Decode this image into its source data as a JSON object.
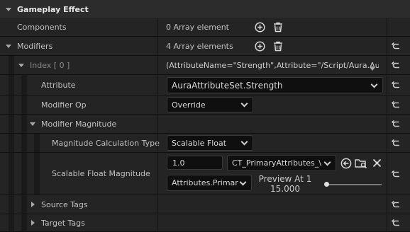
{
  "header": {
    "title": "Gameplay Effect"
  },
  "components": {
    "label": "Components",
    "value": "0 Array element"
  },
  "modifiers": {
    "label": "Modifiers",
    "value": "4 Array elements",
    "index": {
      "label": "Index [ 0 ]",
      "value": "(AttributeName=\"Strength\",Attribute=\"/Script/Aura.Au"
    },
    "attribute": {
      "label": "Attribute",
      "value": "AuraAttributeSet.Strength"
    },
    "modifier_op": {
      "label": "Modifier Op",
      "value": "Override"
    },
    "modifier_magnitude": {
      "label": "Modifier Magnitude"
    },
    "calc_type": {
      "label": "Magnitude Calculation Type",
      "value": "Scalable Float"
    },
    "scalable_float": {
      "label": "Scalable Float Magnitude",
      "value": "1.0",
      "curve_table": "CT_PrimaryAttributes_\\",
      "row_name": "Attributes.Primar",
      "preview_label": "Preview At 1",
      "preview_value": "15.000",
      "preview_level": 0.0
    },
    "source_tags": {
      "label": "Source Tags"
    },
    "target_tags": {
      "label": "Target Tags"
    }
  },
  "icons": [
    "add-icon",
    "trash-icon",
    "reset-arrow-icon",
    "use-selected-icon",
    "browse-icon",
    "clear-icon"
  ],
  "colors": {
    "background": "#1a1a1a",
    "row": "#242424",
    "field": "#0f0f0f",
    "text": "#c0c0c0"
  }
}
